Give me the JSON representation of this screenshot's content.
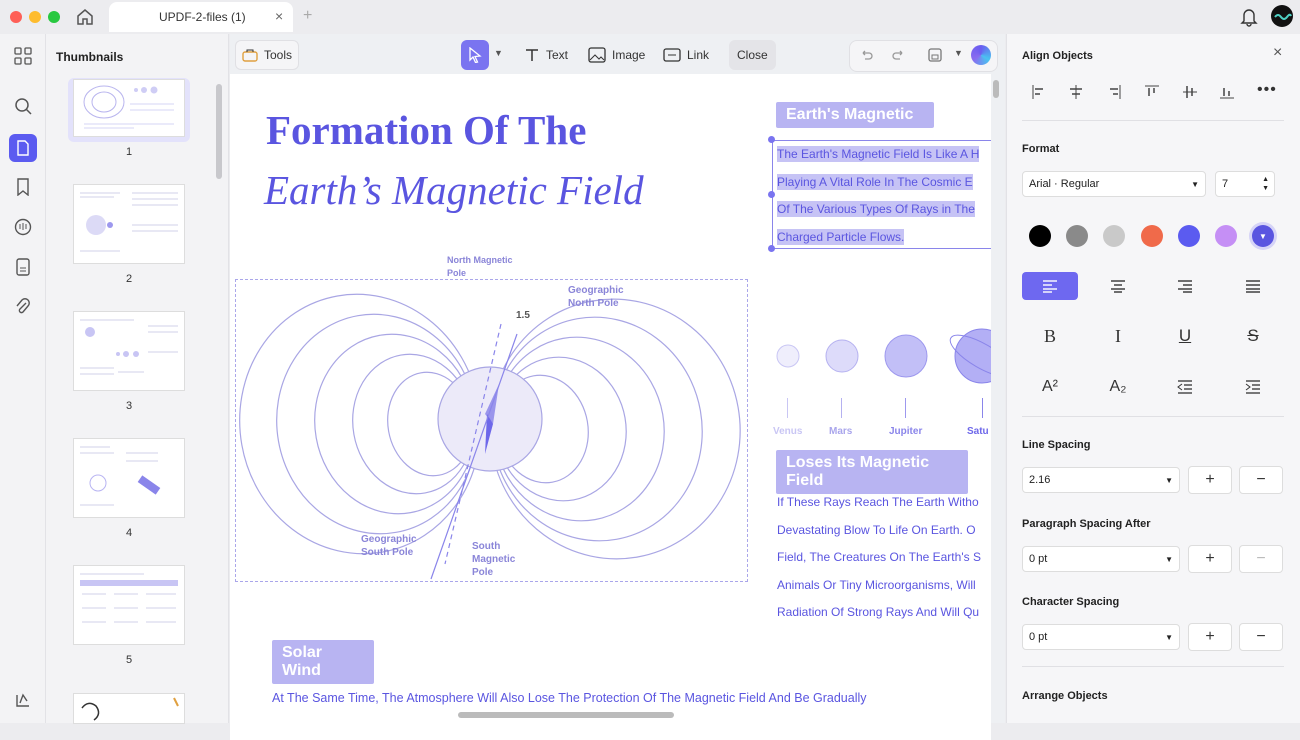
{
  "app": {
    "tab_title": "UPDF-2-files (1)"
  },
  "thumbnails": {
    "title": "Thumbnails",
    "pages": [
      "1",
      "2",
      "3",
      "4",
      "5"
    ]
  },
  "toolbar": {
    "tools_label": "Tools",
    "text_label": "Text",
    "image_label": "Image",
    "link_label": "Link",
    "close_label": "Close"
  },
  "document": {
    "title_line1": "Formation Of The",
    "title_line2": "Earth’s Magnetic Field",
    "section1_title": "Earth's Magnetic",
    "section1_lines": [
      "The Earth's Magnetic Field Is Like A H",
      "Playing A Vital Role In The Cosmic E",
      "Of The Various Types Of Rays in The",
      "Charged Particle Flows."
    ],
    "planets": [
      "Venus",
      "Mars",
      "Jupiter",
      "Satu"
    ],
    "diagram_labels": {
      "north_magnetic": "North Magnetic Pole",
      "geo_north": "Geographic North Pole",
      "angle": "1.5",
      "geo_south": "Geographic South Pole",
      "south_magnetic": "South Magnetic Pole"
    },
    "section2_title": "Loses Its Magnetic Field",
    "section2_lines": [
      "If These Rays Reach The Earth Witho",
      "Devastating Blow To Life On Earth. O",
      "Field, The Creatures On The Earth's S",
      "Animals Or Tiny Microorganisms, Will",
      "Radiation Of Strong Rays And Will Qu"
    ],
    "section3_title": "Solar Wind",
    "section3_line": "At The Same Time, The Atmosphere Will Also Lose The Protection Of The Magnetic Field And Be Gradually"
  },
  "panel": {
    "align_title": "Align Objects",
    "format_title": "Format",
    "font": "Arial · Regular",
    "font_size": "7",
    "colors": [
      "#000000",
      "#8a8a8a",
      "#c9c9c9",
      "#f06a4a",
      "#5b5bf0",
      "#c58ff5",
      "#5a55e0"
    ],
    "line_spacing_title": "Line Spacing",
    "line_spacing": "2.16",
    "para_spacing_title": "Paragraph Spacing After",
    "para_spacing": "0 pt",
    "char_spacing_title": "Character Spacing",
    "char_spacing": "0 pt",
    "arrange_title": "Arrange Objects",
    "plus": "+",
    "minus": "−"
  }
}
